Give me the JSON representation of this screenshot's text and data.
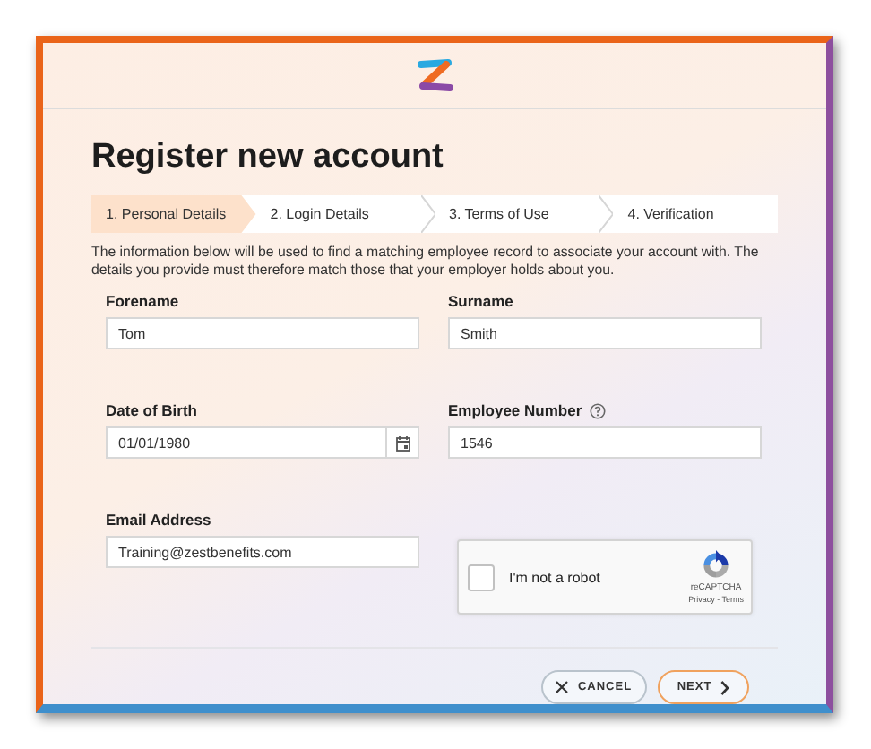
{
  "header": {
    "title": "Register new account"
  },
  "steps": [
    {
      "label": "1. Personal Details",
      "selected": true
    },
    {
      "label": "2. Login Details",
      "selected": false
    },
    {
      "label": "3. Terms of Use",
      "selected": false
    },
    {
      "label": "4. Verification",
      "selected": false
    }
  ],
  "intro": "The information below will be used to find a matching employee record to associate your account with. The details you provide must therefore match those that your employer holds about you.",
  "fields": [
    {
      "label": "Forename",
      "value": "Tom",
      "kind": "text",
      "help": false
    },
    {
      "label": "Surname",
      "value": "Smith",
      "kind": "text",
      "help": false
    },
    {
      "label": "Date of Birth",
      "value": "01/01/1980",
      "kind": "date",
      "help": false
    },
    {
      "label": "Employee Number",
      "value": "1546",
      "kind": "text",
      "help": true
    },
    {
      "label": "Email Address",
      "value": "Training@zestbenefits.com",
      "kind": "text",
      "help": false
    }
  ],
  "captcha": {
    "label": "I'm not a robot",
    "checked": false,
    "brand": "reCAPTCHA",
    "links": "Privacy - Terms"
  },
  "buttons": [
    {
      "label": "CANCEL",
      "kind": "cancel"
    },
    {
      "label": "NEXT",
      "kind": "next"
    }
  ]
}
